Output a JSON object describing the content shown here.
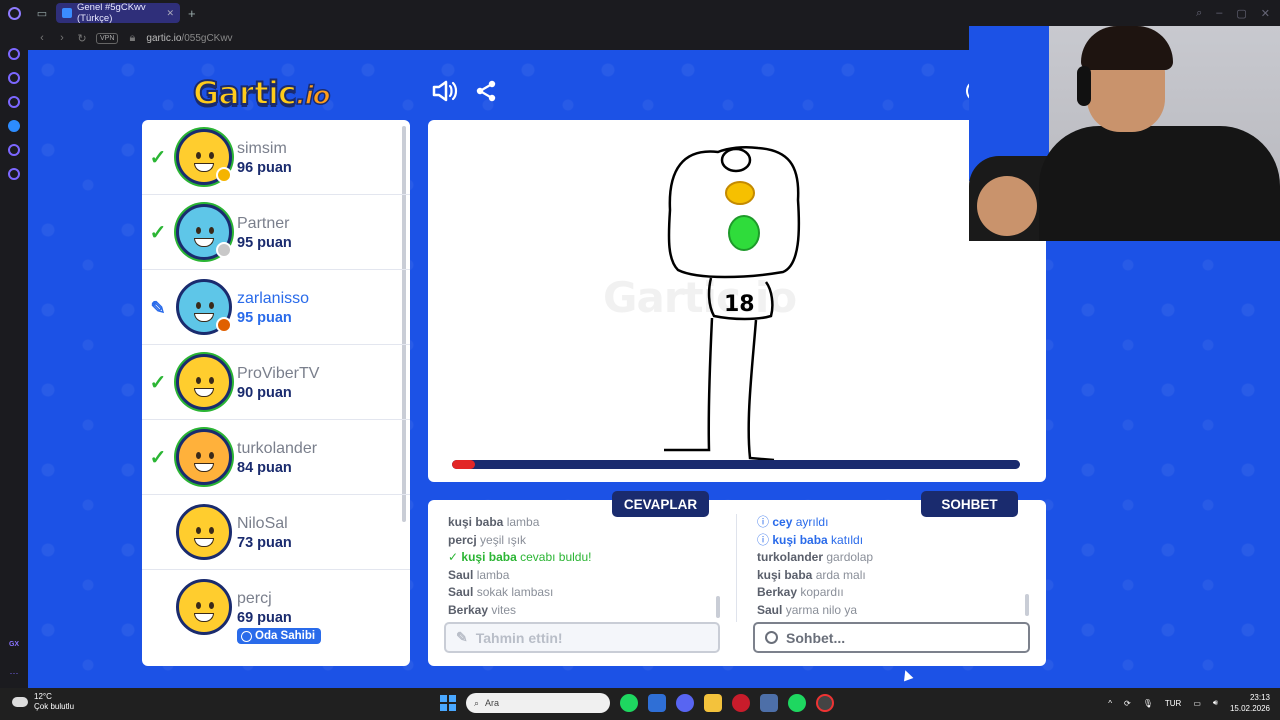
{
  "browser": {
    "tab_title": "Genel #5gCKwv (Türkçe)",
    "url_host": "gartic.io",
    "url_path": "/055gCKwv",
    "vpn_label": "VPN",
    "ai_label": "AI",
    "gx_label": "GX"
  },
  "game": {
    "logo_main": "Gartic",
    "logo_suffix": ".io",
    "watermark": "Gartic.io",
    "progress_fraction": 0.04,
    "drawing_number": "18"
  },
  "players": [
    {
      "name": "simsim",
      "score": "96 puan",
      "status": "guessed",
      "dot_color": "#f5b400"
    },
    {
      "name": "Partner",
      "score": "95 puan",
      "status": "guessed",
      "dot_color": "#c8c8c8"
    },
    {
      "name": "zarlanisso",
      "score": "95 puan",
      "status": "drawing",
      "dot_color": "#e06000"
    },
    {
      "name": "ProViberTV",
      "score": "90 puan",
      "status": "guessed",
      "dot_color": ""
    },
    {
      "name": "turkolander",
      "score": "84 puan",
      "status": "guessed",
      "dot_color": ""
    },
    {
      "name": "NiloSal",
      "score": "73 puan",
      "status": "none",
      "dot_color": ""
    },
    {
      "name": "percj",
      "score": "69 puan",
      "status": "none",
      "dot_color": "",
      "badge": "Oda Sahibi"
    }
  ],
  "answers": {
    "header": "CEVAPLAR",
    "lines": [
      {
        "user": "kuşi baba",
        "text": "lamba",
        "type": "normal"
      },
      {
        "user": "percj",
        "text": "yeşil ışık",
        "type": "normal"
      },
      {
        "user": "kuşi baba",
        "text": "cevabı buldu!",
        "type": "ok"
      },
      {
        "user": "Saul",
        "text": "lamba",
        "type": "normal"
      },
      {
        "user": "Saul",
        "text": "sokak lambası",
        "type": "normal"
      },
      {
        "user": "Berkay",
        "text": "vites",
        "type": "normal"
      }
    ],
    "input_placeholder": "Tahmin ettin!"
  },
  "chat": {
    "header": "SOHBET",
    "lines": [
      {
        "user": "cey",
        "text": "ayrıldı",
        "type": "info"
      },
      {
        "user": "kuşi baba",
        "text": "katıldı",
        "type": "info"
      },
      {
        "user": "turkolander",
        "text": "gardolap",
        "type": "normal"
      },
      {
        "user": "kuşi baba",
        "text": "arda malı",
        "type": "normal"
      },
      {
        "user": "Berkay",
        "text": "kopardıı",
        "type": "normal"
      },
      {
        "user": "Saul",
        "text": "yarma nilo ya",
        "type": "normal"
      }
    ],
    "input_placeholder": "Sohbet..."
  },
  "taskbar": {
    "temperature": "12°C",
    "weather": "Çok bulutlu",
    "search_placeholder": "Ara",
    "language": "TUR",
    "time": "23:13",
    "date": "15.02.2026",
    "weather_badge": "1"
  },
  "colors": {
    "page_bg": "#1c52e6",
    "navy": "#1a2b6e",
    "guessed_green": "#2bb534",
    "drawer_blue": "#2a6bea"
  }
}
